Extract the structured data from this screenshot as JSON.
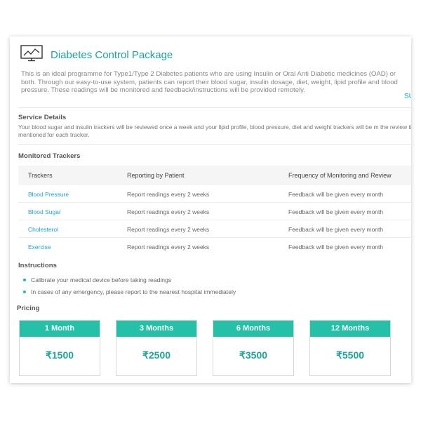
{
  "package": {
    "title": "Diabetes Control Package",
    "icon": "monitor-chart-icon",
    "description": "This is an ideal programme for Type1/Type 2 Diabetes patients who are using Insulin or Oral Anti Diabetic medicines (OAD) or both. Through our easy-to-use system, patients can report their blood sugar, insulin dosage, diet, weight, lipid profile and blood pressure. These readings will be monitored and feedback/instructions will be provided remotely.",
    "side_link": "SU"
  },
  "service": {
    "title": "Service Details",
    "text": "Your blood sugar and insulin trackers will be reviewed once a week and your lipid profile, blood pressure, diet and weight trackers will be m the review timings mentioned for each tracker."
  },
  "trackers": {
    "title": "Monitored Trackers",
    "headers": [
      "Trackers",
      "Reporting by Patient",
      "Frequency of Monitoring and Review"
    ],
    "rows": [
      {
        "name": "Blood Pressure",
        "reporting": "Report readings every 2 weeks",
        "frequency": "Feedback will be given every month"
      },
      {
        "name": "Blood Sugar",
        "reporting": "Report readings every 2 weeks",
        "frequency": "Feedback will be given every month"
      },
      {
        "name": "Cholesterol",
        "reporting": "Report readings every 2 weeks",
        "frequency": "Feedback will be given every month"
      },
      {
        "name": "Exercise",
        "reporting": "Report readings every 2 weeks",
        "frequency": "Feedback will be given every month"
      }
    ]
  },
  "instructions": {
    "title": "Instructions",
    "items": [
      "Calibrate your medical device before taking readings",
      "In cases of any emergency, please report to the nearest hospital immediately"
    ]
  },
  "pricing": {
    "title": "Pricing",
    "plans": [
      {
        "duration": "1 Month",
        "price": "₹1500"
      },
      {
        "duration": "3 Months",
        "price": "₹2500"
      },
      {
        "duration": "6 Months",
        "price": "₹3500"
      },
      {
        "duration": "12 Months",
        "price": "₹5500"
      }
    ]
  },
  "colors": {
    "accent": "#1aa59a",
    "price_header": "#24c1a8",
    "link": "#1aa3d8",
    "bullet": "#1fbfa7"
  }
}
